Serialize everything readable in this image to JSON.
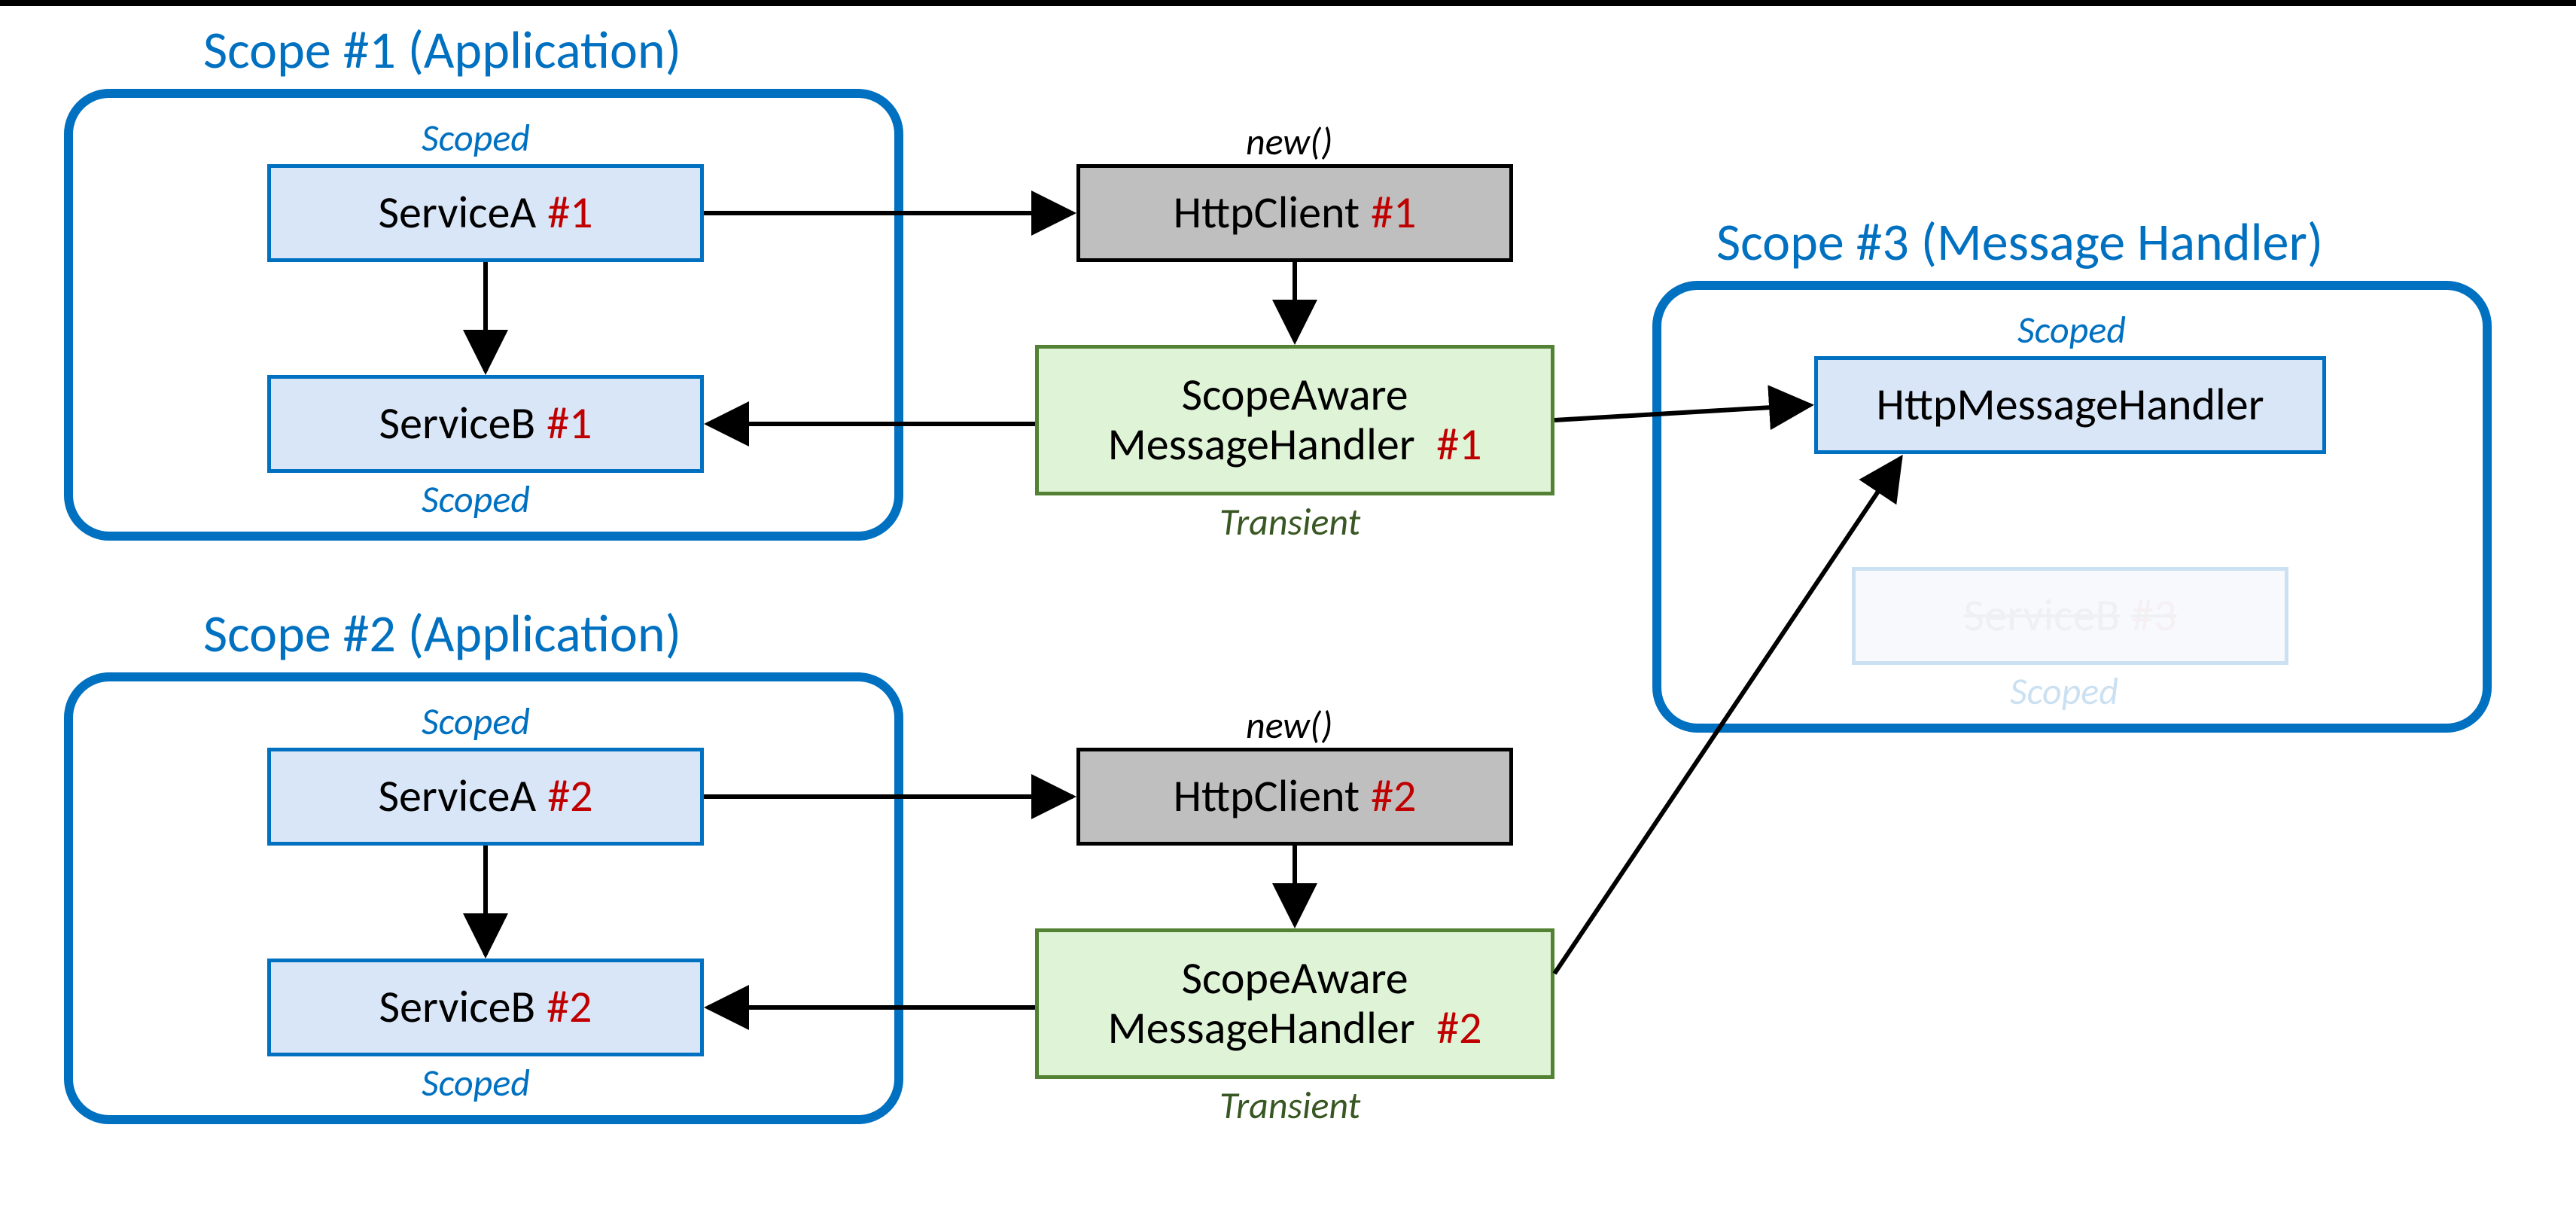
{
  "scope1": {
    "title": "Scope #1 (Application)",
    "serviceA": {
      "name": "ServiceA",
      "inst": "#1",
      "lifetime": "Scoped"
    },
    "serviceB": {
      "name": "ServiceB",
      "inst": "#1",
      "lifetime": "Scoped"
    }
  },
  "col2_top": {
    "httpClient": {
      "name": "HttpClient",
      "inst": "#1",
      "label": "new()"
    },
    "handler": {
      "line1": "ScopeAware",
      "line2_name": "MessageHandler",
      "line2_inst": "#1",
      "lifetime": "Transient"
    }
  },
  "scope2": {
    "title": "Scope #2 (Application)",
    "serviceA": {
      "name": "ServiceA",
      "inst": "#2",
      "lifetime": "Scoped"
    },
    "serviceB": {
      "name": "ServiceB",
      "inst": "#2",
      "lifetime": "Scoped"
    }
  },
  "col2_bot": {
    "httpClient": {
      "name": "HttpClient",
      "inst": "#2",
      "label": "new()"
    },
    "handler": {
      "line1": "ScopeAware",
      "line2_name": "MessageHandler",
      "line2_inst": "#2",
      "lifetime": "Transient"
    }
  },
  "scope3": {
    "title": "Scope #3 (Message Handler)",
    "msgHandler": {
      "name": "HttpMessageHandler",
      "lifetime": "Scoped"
    },
    "serviceB": {
      "name": "ServiceB",
      "inst": "#3",
      "lifetime": "Scoped"
    }
  }
}
